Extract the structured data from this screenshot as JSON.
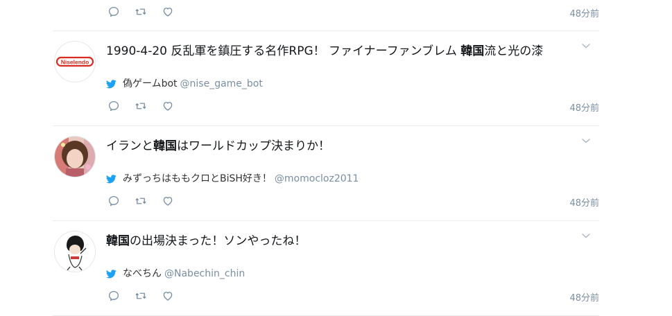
{
  "feed": {
    "top_tweet": {
      "timestamp": "48分前"
    },
    "tweets": [
      {
        "text_before": "1990-4-20 反乱軍を鎮圧する名作RPG！ ファイナーファンブレム ",
        "keyword": "韓国",
        "text_after": "流と光の漆",
        "user_name": "偽ゲームbot",
        "user_handle": "@nise_game_bot",
        "avatar_text": "Niselendo",
        "timestamp": "48分前"
      },
      {
        "text_before": "イランと",
        "keyword": "韓国",
        "text_after": "はワールドカップ決まりか！",
        "user_name": "みずっちはももクロとBiSH好き！",
        "user_handle": "@momocloz2011",
        "timestamp": "48分前"
      },
      {
        "text_before": "",
        "keyword": "韓国",
        "text_after": "の出場決まった！ソンやったね！",
        "user_name": "なべちん",
        "user_handle": "@Nabechin_chin",
        "timestamp": "48分前"
      }
    ]
  },
  "icons": {
    "reply": "reply-icon",
    "retweet": "retweet-icon",
    "like": "heart-icon",
    "bird": "twitter-bird-icon",
    "caret": "chevron-down-icon"
  },
  "colors": {
    "timestamp": "#7a8ea3",
    "twitter_blue": "#1da1f2",
    "divider": "#e6ecf0",
    "action_icon": "#7a8ea3"
  }
}
